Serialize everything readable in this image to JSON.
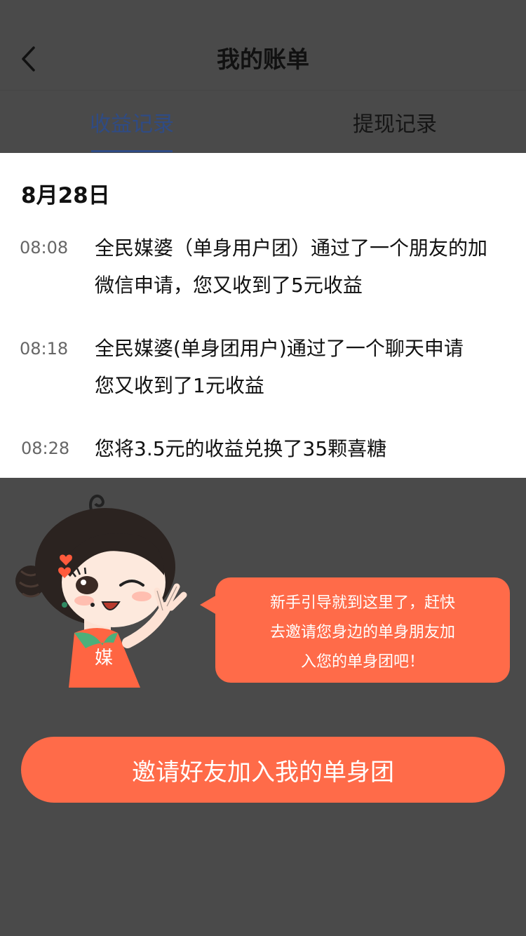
{
  "header": {
    "title": "我的账单"
  },
  "tabs": [
    {
      "label": "收益记录"
    },
    {
      "label": "提现记录"
    }
  ],
  "bills": {
    "date": "8月28日",
    "records": [
      {
        "time": "08:08",
        "line1": "全民媒婆（单身用户团）通过了一个朋友的加",
        "line2": "微信申请，您又收到了5元收益"
      },
      {
        "time": "08:18",
        "line1": "全民媒婆(单身团用户)通过了一个聊天申请",
        "line2": "您又收到了1元收益"
      },
      {
        "time": "08:28",
        "line1": "您将3.5元的收益兑换了35颗喜糖",
        "line2": ""
      }
    ]
  },
  "guide": {
    "mascot_char": "媒",
    "bubble_line1": "新手引导就到这里了，赶快",
    "bubble_line2": "去邀请您身边的单身朋友加",
    "bubble_line3": "入您的单身团吧！"
  },
  "cta": {
    "label": "邀请好友加入我的单身团"
  },
  "colors": {
    "overlay": "#4a4a4a",
    "accent": "#ff6b49",
    "tab_active": "#2f4b84"
  }
}
